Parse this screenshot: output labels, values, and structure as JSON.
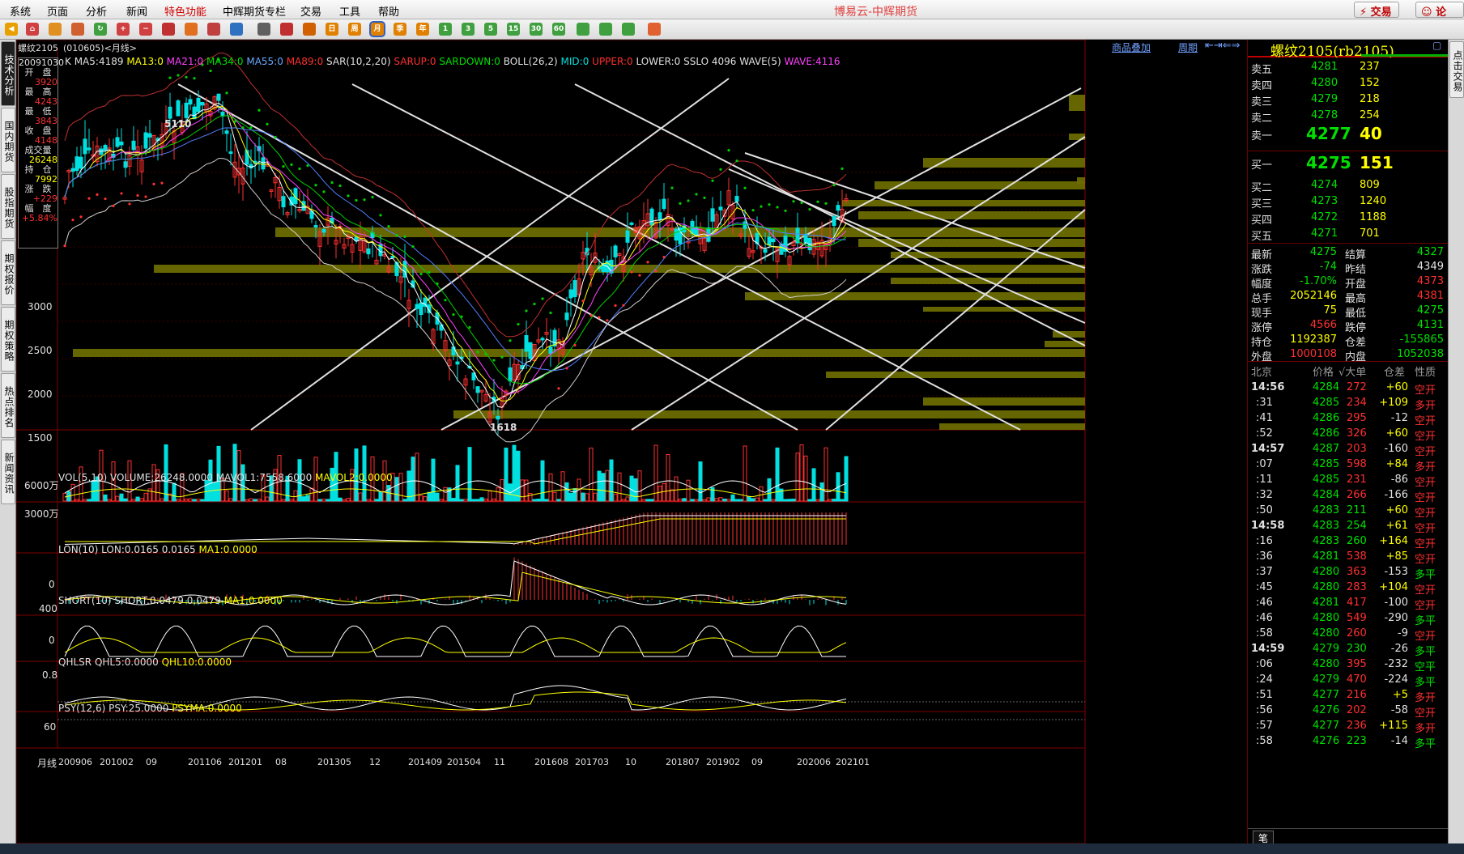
{
  "menu": [
    "系统",
    "页面",
    "分析",
    "新闻",
    "特色功能",
    "中辉期货专栏",
    "交易",
    "工具",
    "帮助"
  ],
  "brand": "博易云-中辉期货",
  "top_buttons": {
    "trade": "交易",
    "forum": "论坛"
  },
  "toolbar_labels": [
    "1",
    "3",
    "5",
    "15",
    "30",
    "60",
    "日",
    "周",
    "月",
    "季",
    "年"
  ],
  "left_tabs": [
    "技术分析",
    "国内期货",
    "股指期货",
    "期权报价",
    "期权策略",
    "热点排名",
    "新闻资讯"
  ],
  "right_tab": "点击交易",
  "chart": {
    "title": "螺纹2105",
    "code_period": "(010605)<月线>",
    "overlay_link": "商品叠加",
    "period_link": "周期",
    "main_indicator": {
      "k": "K",
      "ma5": "MA5:4189",
      "ma13": "MA13:0",
      "ma21": "MA21:0",
      "ma34": "MA34:0",
      "ma55": "MA55:0",
      "ma89": "MA89:0",
      "sar": "SAR(10,2,20)",
      "sarup": "SARUP:0",
      "sardown": "SARDOWN:0",
      "boll": "BOLL(26,2)",
      "mid": "MID:0",
      "upper": "UPPER:0",
      "lower": "LOWER:0",
      "sslo": "SSLO",
      "sslo_val": "4096",
      "wave": "WAVE(5)",
      "wave_val": "WAVE:4116"
    },
    "info_box": {
      "date": "20091030",
      "open_l": "开　盘",
      "open": "3920",
      "high_l": "最　高",
      "high": "4243",
      "low_l": "最　低",
      "low": "3843",
      "close_l": "收　盘",
      "close": "4148",
      "vol_l": "成交量",
      "vol": "26248",
      "oi_l": "持　仓",
      "oi": "7992",
      "chg_l": "涨　跌",
      "chg": "+229",
      "pct_l": "幅　度",
      "pct": "+5.84%"
    },
    "price_ticks": [
      "3000",
      "2500",
      "2000",
      "1500"
    ],
    "annotations": {
      "high": "5110",
      "low": "1618"
    },
    "vol_panel": {
      "label": "VOL(5,10)",
      "volume": "VOLUME:26248.0000",
      "mavol1": "MAVOL1:7558.6000",
      "mavol2": "MAVOL2:0.0000",
      "ticks": [
        "6000万",
        "3000万"
      ]
    },
    "lon_panel": {
      "label": "LON(10)",
      "lon": "LON:0.0165",
      "v": "0.0165",
      "ma1": "MA1:0.0000",
      "tick": "0"
    },
    "short_panel": {
      "label": "SHORT(10)",
      "short": "SHORT:0.0479",
      "v": "0.0479",
      "ma1": "MA1:0.0000",
      "ticks": [
        "400",
        "0"
      ]
    },
    "qhlsr_panel": {
      "label": "QHLSR",
      "q5": "QHL5:0.0000",
      "q10": "QHL10:0.0000",
      "tick": "0.8"
    },
    "psy_panel": {
      "label": "PSY(12,6)",
      "psy": "PSY:25.0000",
      "psyma": "PSYMA:0.0000",
      "tick": "60"
    },
    "x_axis_label": "月线",
    "x_axis": [
      "200906",
      "201002",
      "09",
      "201106",
      "201201",
      "08",
      "201305",
      "12",
      "201409",
      "201504",
      "11",
      "201608",
      "201703",
      "10",
      "201807",
      "201902",
      "09",
      "202006",
      "202101"
    ]
  },
  "quote": {
    "title": "螺纹2105(rb2105)",
    "asks": [
      {
        "l": "卖五",
        "p": "4281",
        "v": "237"
      },
      {
        "l": "卖四",
        "p": "4280",
        "v": "152"
      },
      {
        "l": "卖三",
        "p": "4279",
        "v": "218"
      },
      {
        "l": "卖二",
        "p": "4278",
        "v": "254"
      },
      {
        "l": "卖一",
        "p": "4277",
        "v": "40"
      }
    ],
    "bids": [
      {
        "l": "买一",
        "p": "4275",
        "v": "151"
      },
      {
        "l": "买二",
        "p": "4274",
        "v": "809"
      },
      {
        "l": "买三",
        "p": "4273",
        "v": "1240"
      },
      {
        "l": "买四",
        "p": "4272",
        "v": "1188"
      },
      {
        "l": "买五",
        "p": "4271",
        "v": "701"
      }
    ],
    "stats": [
      {
        "a": "最新",
        "av": "4275",
        "b": "结算",
        "bv": "4327"
      },
      {
        "a": "涨跌",
        "av": "-74",
        "b": "昨结",
        "bv": "4349"
      },
      {
        "a": "幅度",
        "av": "-1.70%",
        "b": "开盘",
        "bv": "4373"
      },
      {
        "a": "总手",
        "av": "2052146",
        "b": "最高",
        "bv": "4381"
      },
      {
        "a": "现手",
        "av": "75",
        "b": "最低",
        "bv": "4275"
      },
      {
        "a": "涨停",
        "av": "4566",
        "b": "跌停",
        "bv": "4131"
      },
      {
        "a": "持仓",
        "av": "1192387",
        "b": "仓差",
        "bv": "-155865"
      },
      {
        "a": "外盘",
        "av": "1000108",
        "b": "内盘",
        "bv": "1052038"
      }
    ],
    "tick_header": {
      "t": "北京",
      "p": "价格",
      "v": "√大单",
      "d": "仓差",
      "n": "性质"
    },
    "ticks": [
      {
        "t": "14:56",
        "p": "4284",
        "v": "272",
        "d": "+60",
        "n": "空开"
      },
      {
        "t": ":31",
        "p": "4285",
        "v": "234",
        "d": "+109",
        "n": "多开"
      },
      {
        "t": ":41",
        "p": "4286",
        "v": "295",
        "d": "-12",
        "n": "空开"
      },
      {
        "t": ":52",
        "p": "4286",
        "v": "326",
        "d": "+60",
        "n": "空开"
      },
      {
        "t": "14:57",
        "p": "4287",
        "v": "203",
        "d": "-160",
        "n": "空开"
      },
      {
        "t": ":07",
        "p": "4285",
        "v": "598",
        "d": "+84",
        "n": "多开"
      },
      {
        "t": ":11",
        "p": "4285",
        "v": "231",
        "d": "-86",
        "n": "空开"
      },
      {
        "t": ":32",
        "p": "4284",
        "v": "266",
        "d": "-166",
        "n": "空开"
      },
      {
        "t": ":50",
        "p": "4283",
        "v": "211",
        "d": "+60",
        "n": "空开"
      },
      {
        "t": "14:58",
        "p": "4283",
        "v": "254",
        "d": "+61",
        "n": "空开"
      },
      {
        "t": ":16",
        "p": "4283",
        "v": "260",
        "d": "+164",
        "n": "空开"
      },
      {
        "t": ":36",
        "p": "4281",
        "v": "538",
        "d": "+85",
        "n": "空开"
      },
      {
        "t": ":37",
        "p": "4280",
        "v": "363",
        "d": "-153",
        "n": "多平"
      },
      {
        "t": ":45",
        "p": "4280",
        "v": "283",
        "d": "+104",
        "n": "空开"
      },
      {
        "t": ":46",
        "p": "4281",
        "v": "417",
        "d": "-100",
        "n": "空开"
      },
      {
        "t": ":46",
        "p": "4280",
        "v": "549",
        "d": "-290",
        "n": "多平"
      },
      {
        "t": ":58",
        "p": "4280",
        "v": "260",
        "d": "-9",
        "n": "空开"
      },
      {
        "t": "14:59",
        "p": "4279",
        "v": "230",
        "d": "-26",
        "n": "多平"
      },
      {
        "t": ":06",
        "p": "4280",
        "v": "395",
        "d": "-232",
        "n": "空平"
      },
      {
        "t": ":24",
        "p": "4279",
        "v": "470",
        "d": "-224",
        "n": "多平"
      },
      {
        "t": ":51",
        "p": "4277",
        "v": "216",
        "d": "+5",
        "n": "多开"
      },
      {
        "t": ":56",
        "p": "4276",
        "v": "202",
        "d": "-58",
        "n": "空开"
      },
      {
        "t": ":57",
        "p": "4277",
        "v": "236",
        "d": "+115",
        "n": "多开"
      },
      {
        "t": ":58",
        "p": "4276",
        "v": "223",
        "d": "-14",
        "n": "多平"
      }
    ],
    "bottom_tab": "笔"
  }
}
